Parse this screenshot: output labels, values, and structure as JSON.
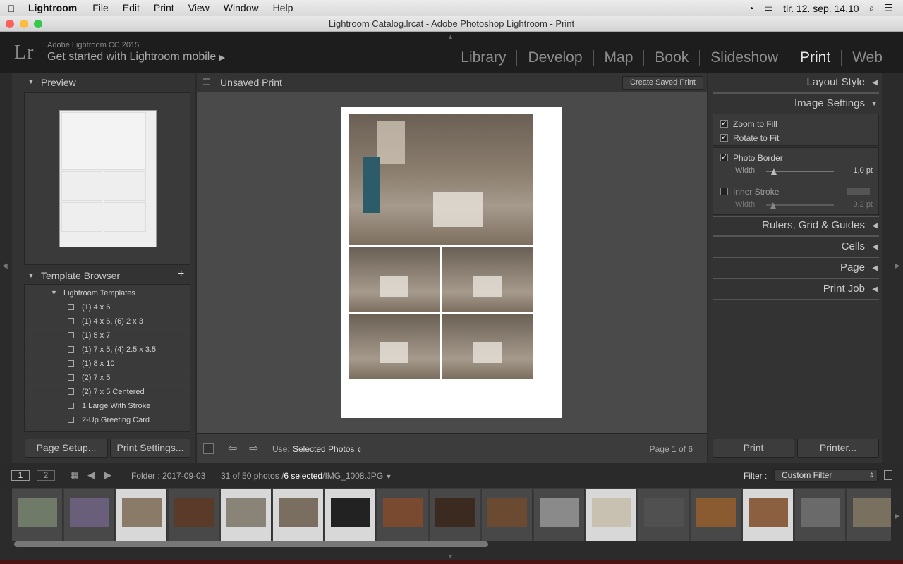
{
  "menubar": {
    "app": "Lightroom",
    "items": [
      "File",
      "Edit",
      "Print",
      "View",
      "Window",
      "Help"
    ],
    "clock": "tir. 12. sep. 14.10"
  },
  "window": {
    "title": "Lightroom Catalog.lrcat - Adobe Photoshop Lightroom - Print"
  },
  "identity": {
    "logo": "Lr",
    "product": "Adobe Lightroom CC 2015",
    "promo": "Get started with Lightroom mobile"
  },
  "modules": [
    {
      "label": "Library"
    },
    {
      "label": "Develop"
    },
    {
      "label": "Map"
    },
    {
      "label": "Book"
    },
    {
      "label": "Slideshow"
    },
    {
      "label": "Print",
      "active": true
    },
    {
      "label": "Web"
    }
  ],
  "left": {
    "preview_title": "Preview",
    "template_browser_title": "Template Browser",
    "add_symbol": "+",
    "folder": "Lightroom Templates",
    "templates": [
      "(1) 4 x 6",
      "(1) 4 x 6, (6) 2 x 3",
      "(1) 5 x 7",
      "(1) 7 x 5, (4) 2.5 x 3.5",
      "(1) 8 x 10",
      "(2) 7 x 5",
      "(2) 7 x 5 Centered",
      "1 Large With Stroke",
      "2-Up Greeting Card"
    ],
    "page_setup": "Page Setup...",
    "print_settings": "Print Settings..."
  },
  "center": {
    "title": "Unsaved Print",
    "create_saved": "Create Saved Print"
  },
  "toolbar": {
    "use_label": "Use:",
    "use_value": "Selected Photos",
    "page_info": "Page 1 of 6"
  },
  "right": {
    "layout_style": "Layout Style",
    "image_settings": "Image Settings",
    "zoom_to_fill": "Zoom to Fill",
    "rotate_to_fit": "Rotate to Fit",
    "photo_border": "Photo Border",
    "width_label": "Width",
    "border_width": "1,0 pt",
    "border_width_fraction": 0.02,
    "inner_stroke": "Inner Stroke",
    "stroke_width": "0,2 pt",
    "stroke_width_fraction": 0.01,
    "rulers": "Rulers, Grid & Guides",
    "cells": "Cells",
    "page": "Page",
    "print_job": "Print Job",
    "print_btn": "Print",
    "printer_btn": "Printer..."
  },
  "filmbar": {
    "screen1": "1",
    "screen2": "2",
    "folder": "Folder : 2017-09-03",
    "count": "31 of 50 photos /",
    "selected": "6 selected",
    "file": "/IMG_1008.JPG",
    "filter_label": "Filter :",
    "filter_value": "Custom Filter"
  },
  "colors": {
    "accent_active": "#e6e6e6",
    "panel": "#333333"
  }
}
